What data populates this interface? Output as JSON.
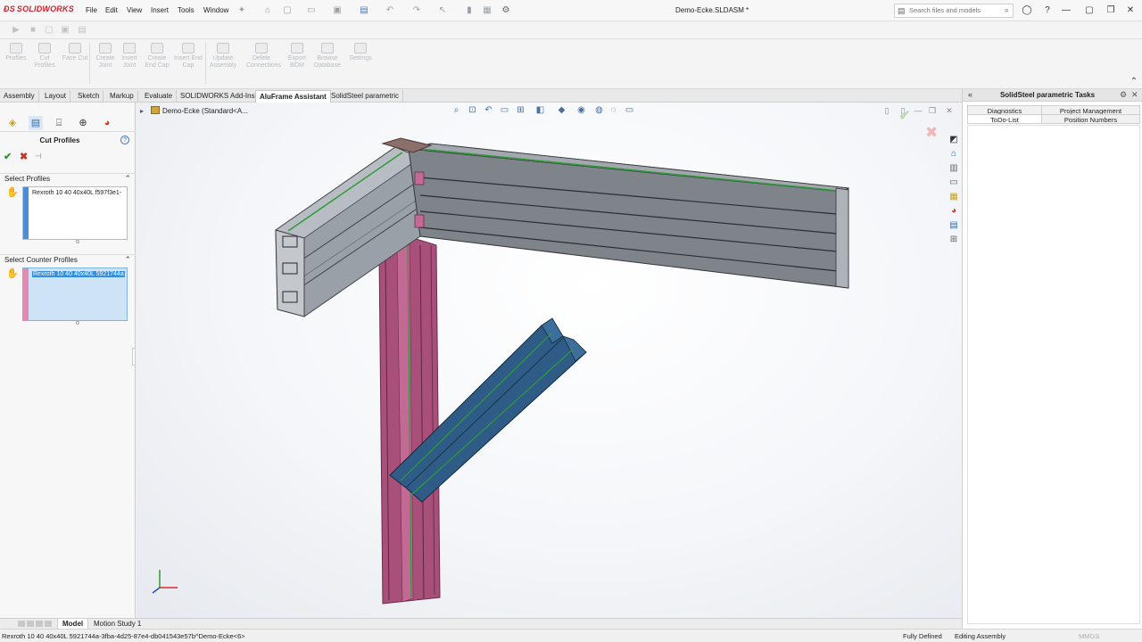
{
  "app": {
    "logo": "SOLIDWORKS",
    "document_title": "Demo-Ecke.SLDASM *"
  },
  "menu": [
    "File",
    "Edit",
    "View",
    "Insert",
    "Tools",
    "Window"
  ],
  "search": {
    "placeholder": "Search files and models"
  },
  "commands": [
    "Profiles",
    "Cut Profiles",
    "Face Cut",
    "Create Joint",
    "Insert Joint",
    "Create End Cap",
    "Insert End Cap",
    "Update Assembly",
    "Delete Connections",
    "Export BOM",
    "Browse Database",
    "Settings"
  ],
  "tabs": [
    {
      "label": "Assembly",
      "active": false
    },
    {
      "label": "Layout",
      "active": false
    },
    {
      "label": "Sketch",
      "active": false
    },
    {
      "label": "Markup",
      "active": false
    },
    {
      "label": "Evaluate",
      "active": false
    },
    {
      "label": "SOLIDWORKS Add-Ins",
      "active": false
    },
    {
      "label": "AluFrame Assistant",
      "active": true
    },
    {
      "label": "SolidSteel parametric",
      "active": false
    }
  ],
  "property_manager": {
    "title": "Cut Profiles",
    "select_profiles": {
      "label": "Select Profiles",
      "value": "Rexroth 10 40 40x40L f597f3e1-"
    },
    "select_counter_profiles": {
      "label": "Select Counter Profiles",
      "value": "Rexroth 10 40 40x40L 5921744a"
    }
  },
  "viewport": {
    "tree_root": "Demo-Ecke  (Standard<A..."
  },
  "task_pane": {
    "title": "SolidSteel parametric Tasks",
    "tabs_row1": [
      "Diagnostics",
      "Project Management"
    ],
    "tabs_row2": [
      "ToDo-List",
      "Position Numbers"
    ]
  },
  "model_tabs": [
    "Model",
    "Motion Study 1"
  ],
  "status": {
    "selection": "Rexroth 10 40 40x40L 5921744a-3fba-4d25-87e4-db041543e57b^Demo-Ecke<6>",
    "definition": "Fully Defined",
    "mode": "Editing Assembly",
    "units": "MMGS"
  },
  "colors": {
    "brand_red": "#d2222a",
    "profile_gray": "#8b9097",
    "profile_magenta": "#a8507a",
    "profile_blue": "#2f5c86",
    "edge_green": "#2f9a3c"
  }
}
